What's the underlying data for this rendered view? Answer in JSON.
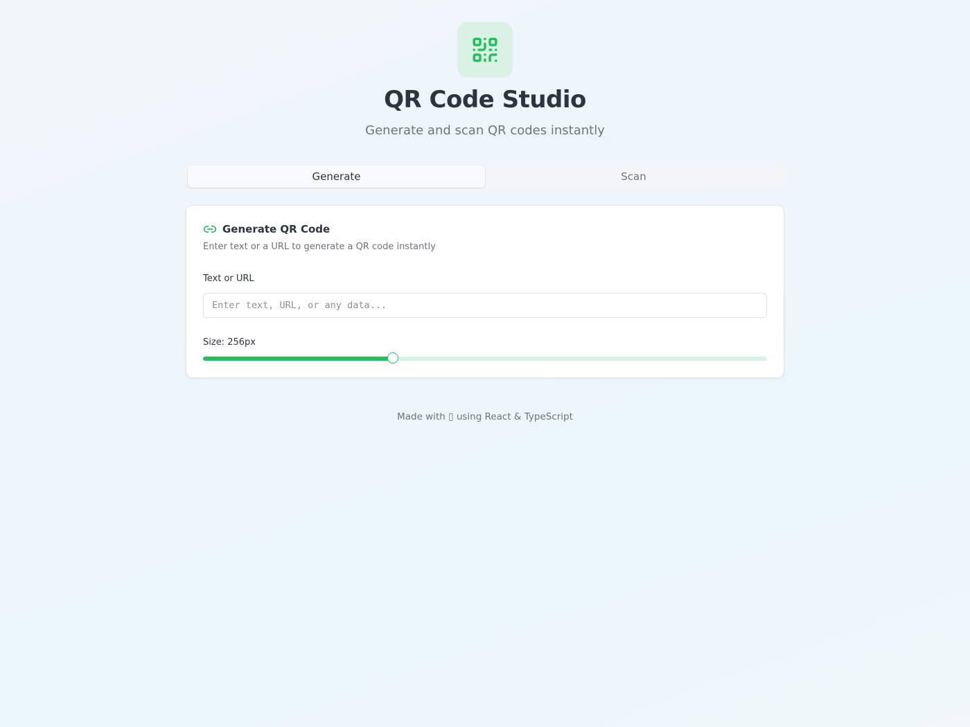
{
  "header": {
    "logo_icon": "qr-code-icon",
    "title": "QR Code Studio",
    "subtitle": "Generate and scan QR codes instantly"
  },
  "tabs": [
    {
      "label": "Generate",
      "active": true
    },
    {
      "label": "Scan",
      "active": false
    }
  ],
  "card": {
    "icon": "link-icon",
    "title": "Generate QR Code",
    "description": "Enter text or a URL to generate a QR code instantly",
    "text_field": {
      "label": "Text or URL",
      "placeholder": "Enter text, URL, or any data...",
      "value": ""
    },
    "size": {
      "label": "Size: 256px",
      "fraction": 0.337
    }
  },
  "footer": {
    "text": "Made with ▯ using React & TypeScript"
  },
  "colors": {
    "accent": "#22c15e",
    "accent_light": "#d8f1e2",
    "logo_bg": "#d9f2e4"
  }
}
